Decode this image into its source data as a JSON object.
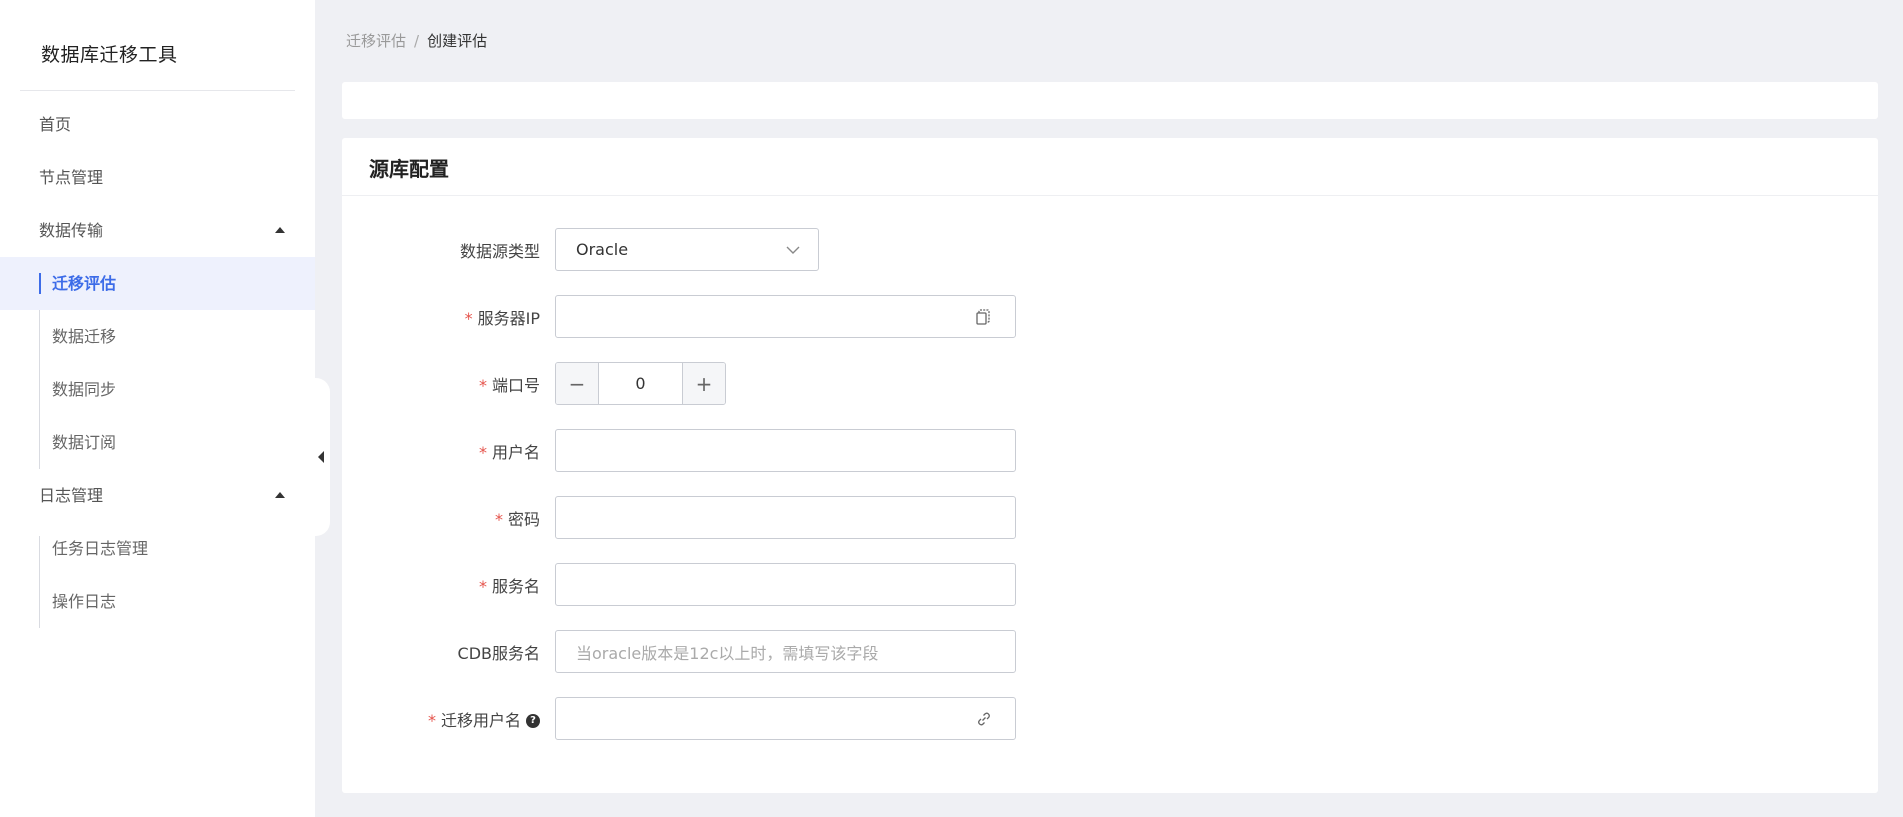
{
  "app": {
    "title": "数据库迁移工具"
  },
  "sidebar": {
    "items": [
      {
        "label": "首页"
      },
      {
        "label": "节点管理"
      },
      {
        "label": "数据传输",
        "children": [
          {
            "label": "迁移评估",
            "active": true
          },
          {
            "label": "数据迁移"
          },
          {
            "label": "数据同步"
          },
          {
            "label": "数据订阅"
          }
        ]
      },
      {
        "label": "日志管理",
        "children": [
          {
            "label": "任务日志管理"
          },
          {
            "label": "操作日志"
          }
        ]
      }
    ]
  },
  "breadcrumb": {
    "parent": "迁移评估",
    "separator": "/",
    "current": "创建评估"
  },
  "form": {
    "section_title": "源库配置",
    "fields": {
      "source_type": {
        "label": "数据源类型",
        "value": "Oracle"
      },
      "server_ip": {
        "label": "服务器IP",
        "value": "",
        "suffix_icon": "copy-icon"
      },
      "port": {
        "label": "端口号",
        "value": "0",
        "minus": "−",
        "plus": "+"
      },
      "username": {
        "label": "用户名",
        "value": ""
      },
      "password": {
        "label": "密码",
        "value": ""
      },
      "service_name": {
        "label": "服务名",
        "value": ""
      },
      "cdb_service_name": {
        "label": "CDB服务名",
        "placeholder": "当oracle版本是12c以上时，需填写该字段"
      },
      "migration_user": {
        "label": "迁移用户名",
        "value": "",
        "help": "?",
        "suffix_icon": "link-icon"
      }
    },
    "required_mark": "*"
  },
  "colors": {
    "accent": "#3d6ce8",
    "required": "#e5534b",
    "background": "#eff0f4"
  }
}
